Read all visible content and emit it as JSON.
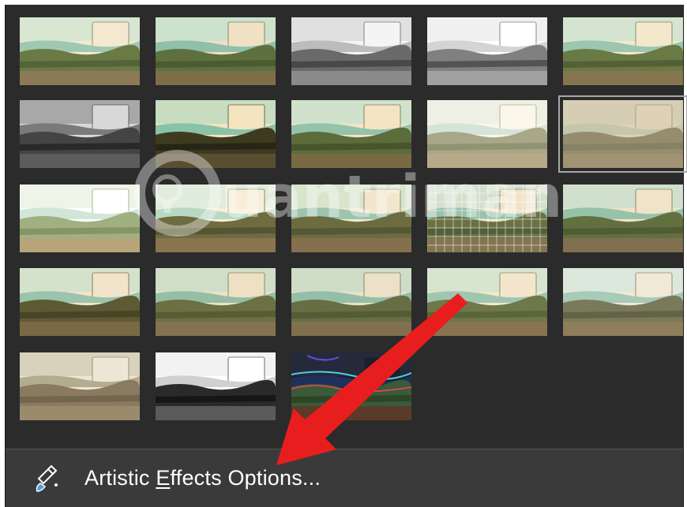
{
  "gallery": {
    "thumbnails": [
      {
        "effect": "none",
        "selected": false
      },
      {
        "effect": "marker",
        "selected": false
      },
      {
        "effect": "pencil-grayscale",
        "selected": false
      },
      {
        "effect": "pencil-sketch",
        "selected": false
      },
      {
        "effect": "line-drawing",
        "selected": false
      },
      {
        "effect": "chalk-sketch",
        "selected": false
      },
      {
        "effect": "paint-strokes",
        "selected": false
      },
      {
        "effect": "paint-brush",
        "selected": false
      },
      {
        "effect": "glow-diffused",
        "selected": false
      },
      {
        "effect": "blur",
        "selected": true
      },
      {
        "effect": "light-screen",
        "selected": false
      },
      {
        "effect": "watercolor-sponge",
        "selected": false
      },
      {
        "effect": "film-grain",
        "selected": false
      },
      {
        "effect": "mosaic-bubbles",
        "selected": false
      },
      {
        "effect": "glass",
        "selected": false
      },
      {
        "effect": "cement",
        "selected": false
      },
      {
        "effect": "texturizer",
        "selected": false
      },
      {
        "effect": "crisscross-etching",
        "selected": false
      },
      {
        "effect": "pastels-smooth",
        "selected": false
      },
      {
        "effect": "plastic-wrap",
        "selected": false
      },
      {
        "effect": "cutout",
        "selected": false
      },
      {
        "effect": "photocopy",
        "selected": false
      },
      {
        "effect": "glow-edges",
        "selected": false
      }
    ]
  },
  "options": {
    "label_pre": "Artistic ",
    "label_key": "E",
    "label_post": "ffects Options...",
    "icon": "paint-brush-options-icon"
  },
  "watermark": {
    "text": "uantrimang",
    "icon": "lightbulb-logo-icon"
  },
  "annotation": {
    "icon": "red-arrow-icon",
    "color": "#e81e1e"
  },
  "colors": {
    "panel": "#2b2b2b",
    "footer": "#3a3a3a",
    "text": "#ffffff"
  }
}
